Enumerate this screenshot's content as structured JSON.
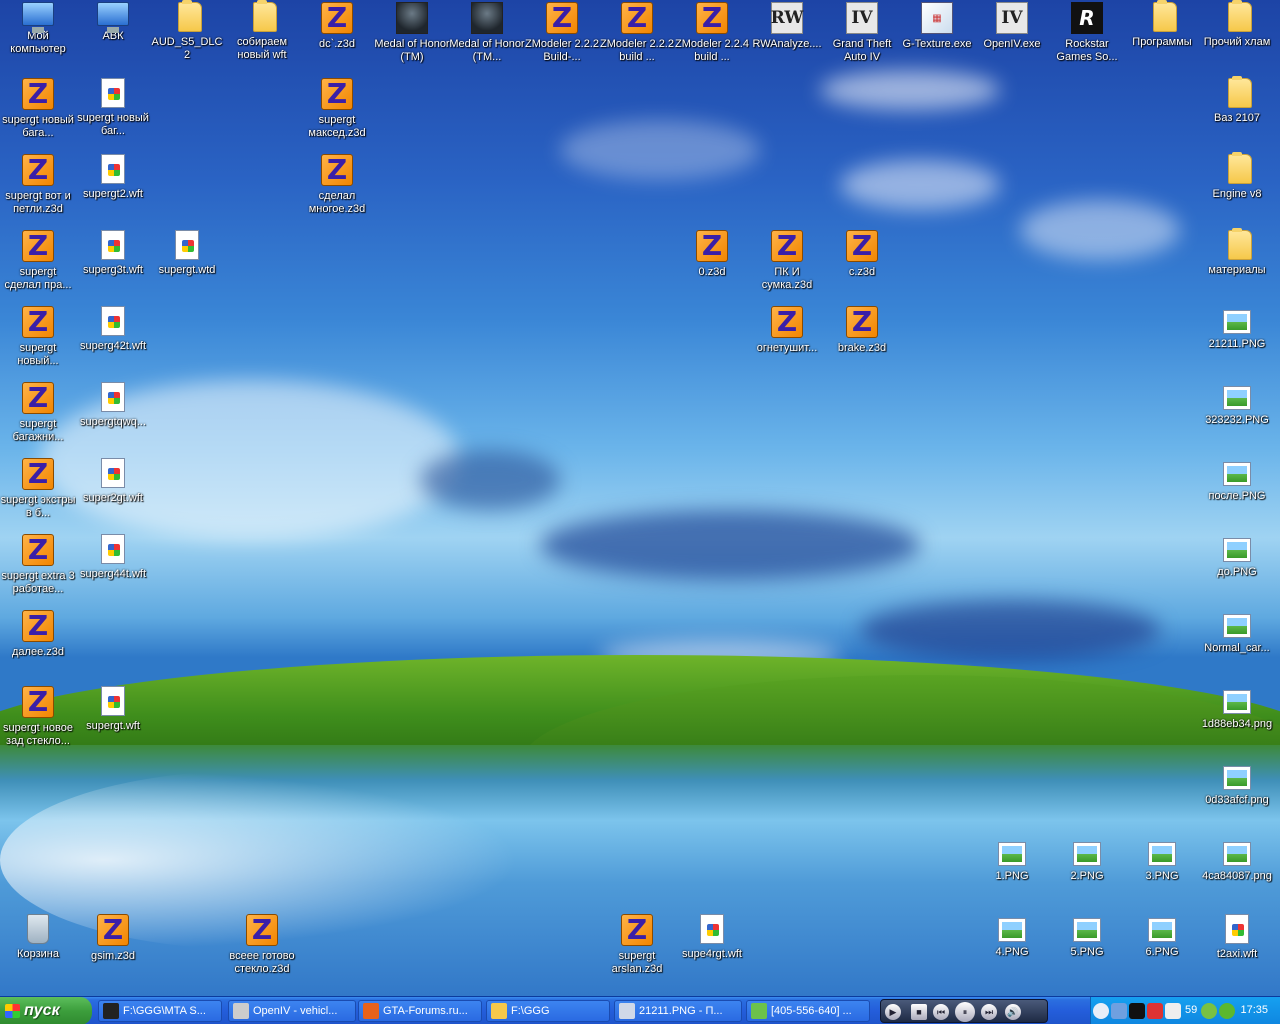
{
  "desktop": {
    "icons": [
      {
        "label": "Мой компьютер",
        "type": "pc",
        "icon": "my-computer-icon"
      },
      {
        "label": "АВК",
        "type": "pc",
        "icon": "network-pc-icon"
      },
      {
        "label": "AUD_S5_DLC2",
        "type": "folder",
        "icon": "folder-icon"
      },
      {
        "label": "собираем новый wft",
        "type": "folder",
        "icon": "folder-icon"
      },
      {
        "label": "dc`.z3d",
        "type": "zmod",
        "icon": "zmodeler-file-icon"
      },
      {
        "label": "Medal of Honor (TM)",
        "type": "game",
        "icon": "medal-of-honor-icon"
      },
      {
        "label": "Medal of Honor (TM...",
        "type": "game",
        "icon": "medal-of-honor-icon"
      },
      {
        "label": "ZModeler 2.2.2 Build-...",
        "type": "zmod",
        "icon": "zmodeler-icon"
      },
      {
        "label": "ZModeler 2.2.2 build ...",
        "type": "zmod",
        "icon": "zmodeler-icon"
      },
      {
        "label": "ZModeler 2.2.4 build ...",
        "type": "zmod",
        "icon": "zmodeler-icon"
      },
      {
        "label": "RWAnalyze....",
        "type": "exe",
        "icon": "rwanalyze-icon",
        "glyph": "RW"
      },
      {
        "label": "Grand Theft Auto IV",
        "type": "exe",
        "icon": "gta-iv-icon",
        "glyph": "IV"
      },
      {
        "label": "G-Texture.exe",
        "type": "tex",
        "icon": "g-texture-icon",
        "glyph": "▦"
      },
      {
        "label": "OpenIV.exe",
        "type": "exe",
        "icon": "openiv-icon",
        "glyph": "IV"
      },
      {
        "label": "Rockstar Games So...",
        "type": "rs",
        "icon": "rockstar-icon",
        "glyph": "R"
      },
      {
        "label": "Программы",
        "type": "folder",
        "icon": "folder-icon"
      },
      {
        "label": "Прочий хлам",
        "type": "folder",
        "icon": "folder-icon"
      },
      {
        "label": "supergt новый бага...",
        "type": "zmod",
        "icon": "zmodeler-file-icon"
      },
      {
        "label": "supergt новый баг...",
        "type": "file",
        "icon": "wft-file-icon"
      },
      {
        "label": "supergt максед.z3d",
        "type": "zmod",
        "icon": "zmodeler-file-icon"
      },
      {
        "label": "Ваз 2107",
        "type": "folder",
        "icon": "folder-icon"
      },
      {
        "label": "supergt вот и петли.z3d",
        "type": "zmod",
        "icon": "zmodeler-file-icon"
      },
      {
        "label": "supergt2.wft",
        "type": "file",
        "icon": "wft-file-icon"
      },
      {
        "label": "сделал многое.z3d",
        "type": "zmod",
        "icon": "zmodeler-file-icon"
      },
      {
        "label": "Engine v8",
        "type": "folder",
        "icon": "folder-icon"
      },
      {
        "label": "supergt сделал пра...",
        "type": "zmod",
        "icon": "zmodeler-file-icon"
      },
      {
        "label": "superg3t.wft",
        "type": "file",
        "icon": "wft-file-icon"
      },
      {
        "label": "supergt.wtd",
        "type": "file",
        "icon": "wtd-file-icon"
      },
      {
        "label": "0.z3d",
        "type": "zmod",
        "icon": "zmodeler-file-icon"
      },
      {
        "label": "ПК И сумка.z3d",
        "type": "zmod",
        "icon": "zmodeler-file-icon"
      },
      {
        "label": "c.z3d",
        "type": "zmod",
        "icon": "zmodeler-file-icon"
      },
      {
        "label": "материалы",
        "type": "folder",
        "icon": "folder-icon"
      },
      {
        "label": "supergt новый...",
        "type": "zmod",
        "icon": "zmodeler-file-icon"
      },
      {
        "label": "superg42t.wft",
        "type": "file",
        "icon": "wft-file-icon"
      },
      {
        "label": "огнетушит...",
        "type": "zmod",
        "icon": "zmodeler-file-icon"
      },
      {
        "label": "brake.z3d",
        "type": "zmod",
        "icon": "zmodeler-file-icon"
      },
      {
        "label": "21211.PNG",
        "type": "png",
        "icon": "png-image-icon"
      },
      {
        "label": "supergt багажни...",
        "type": "zmod",
        "icon": "zmodeler-file-icon"
      },
      {
        "label": "supergtqwq...",
        "type": "file",
        "icon": "wft-file-icon"
      },
      {
        "label": "323232.PNG",
        "type": "png",
        "icon": "png-image-icon"
      },
      {
        "label": "supergt экстры в б...",
        "type": "zmod",
        "icon": "zmodeler-file-icon"
      },
      {
        "label": "super2gt.wft",
        "type": "file",
        "icon": "wft-file-icon"
      },
      {
        "label": "после.PNG",
        "type": "png",
        "icon": "png-image-icon"
      },
      {
        "label": "supergt extra 3 работае...",
        "type": "zmod",
        "icon": "zmodeler-file-icon"
      },
      {
        "label": "superg44t.wft",
        "type": "file",
        "icon": "wft-file-icon"
      },
      {
        "label": "до.PNG",
        "type": "png",
        "icon": "png-image-icon"
      },
      {
        "label": "далее.z3d",
        "type": "zmod",
        "icon": "zmodeler-file-icon"
      },
      {
        "label": "Normal_car...",
        "type": "png",
        "icon": "png-image-icon"
      },
      {
        "label": "supergt новое зад стекло...",
        "type": "zmod",
        "icon": "zmodeler-file-icon"
      },
      {
        "label": "supergt.wft",
        "type": "file",
        "icon": "wft-file-icon"
      },
      {
        "label": "1d88eb34.png",
        "type": "png",
        "icon": "png-image-icon"
      },
      {
        "label": "0d33afcf.png",
        "type": "png",
        "icon": "png-image-icon"
      },
      {
        "label": "1.PNG",
        "type": "png",
        "icon": "png-image-icon"
      },
      {
        "label": "2.PNG",
        "type": "png",
        "icon": "png-image-icon"
      },
      {
        "label": "3.PNG",
        "type": "png",
        "icon": "png-image-icon"
      },
      {
        "label": "4ca84087.png",
        "type": "png",
        "icon": "png-image-icon"
      },
      {
        "label": "Корзина",
        "type": "bin",
        "icon": "recycle-bin-icon"
      },
      {
        "label": "gsim.z3d",
        "type": "zmod",
        "icon": "zmodeler-file-icon"
      },
      {
        "label": "всеее готово стекло.z3d",
        "type": "zmod",
        "icon": "zmodeler-file-icon"
      },
      {
        "label": "supergt arslan.z3d",
        "type": "zmod",
        "icon": "zmodeler-file-icon"
      },
      {
        "label": "supe4rgt.wft",
        "type": "file",
        "icon": "wft-file-icon"
      },
      {
        "label": "4.PNG",
        "type": "png",
        "icon": "png-image-icon"
      },
      {
        "label": "5.PNG",
        "type": "png",
        "icon": "png-image-icon"
      },
      {
        "label": "6.PNG",
        "type": "png",
        "icon": "png-image-icon"
      },
      {
        "label": "t2axi.wft",
        "type": "file",
        "icon": "wft-file-icon"
      }
    ]
  },
  "taskbar": {
    "start_label": "пуск",
    "tasks": [
      {
        "label": "F:\\GGG\\MTA S...",
        "icon": "console-icon",
        "color": "#222222"
      },
      {
        "label": "OpenIV - vehicl...",
        "icon": "openiv-icon",
        "color": "#cccccc"
      },
      {
        "label": "GTA-Forums.ru...",
        "icon": "firefox-icon",
        "color": "#e8621a"
      },
      {
        "label": "F:\\GGG",
        "icon": "folder-icon",
        "color": "#f6c84a"
      },
      {
        "label": "21211.PNG - П...",
        "icon": "paint-icon",
        "color": "#d0d8e8"
      },
      {
        "label": "[405-556-640] ...",
        "icon": "chat-icon",
        "color": "#6cc24a"
      }
    ],
    "clock": "17:35",
    "tray_number": "59"
  }
}
